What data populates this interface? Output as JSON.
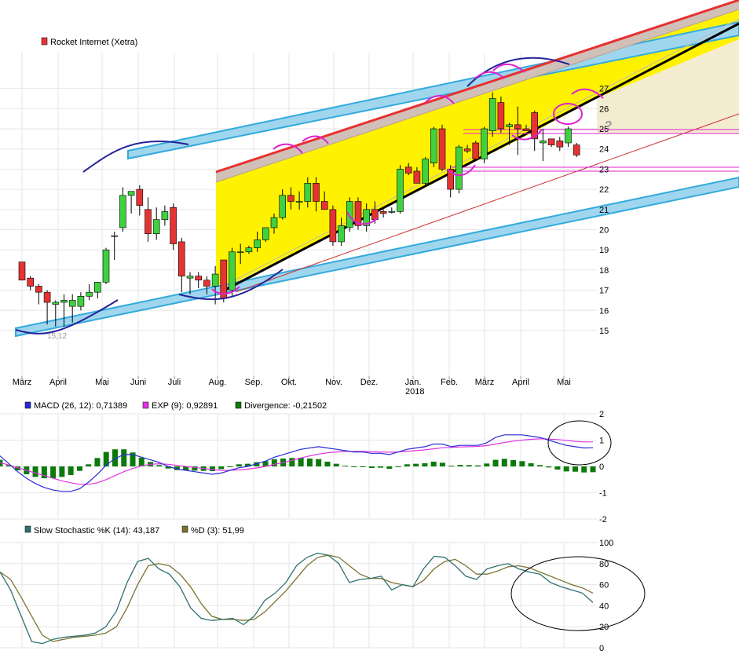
{
  "colors": {
    "up": "#3fd13f",
    "down": "#e53333",
    "macd": "#2b2bd6",
    "signal": "#e033e0",
    "divergence": "#0a7a0a",
    "stoch_k": "#2e7070",
    "stoch_d": "#7a7330",
    "channel_fill": "#fff200",
    "band_blue": "#33aadd",
    "annot_blue": "#232399",
    "annot_magenta": "#e020d0"
  },
  "chart_data": [
    {
      "type": "candlestick",
      "legend": "Rocket Internet (Xetra)",
      "ylim": [
        14,
        28
      ],
      "y_ticks": [
        15,
        16,
        17,
        18,
        19,
        20,
        21,
        22,
        23,
        24,
        25,
        26,
        27
      ],
      "x_tick_labels": [
        "März",
        "April",
        "Mai",
        "Juni",
        "Juli",
        "Aug.",
        "Sep.",
        "Okt.",
        "Nov.",
        "Dez.",
        "Jan.",
        "Feb.",
        "März",
        "April",
        "Mai"
      ],
      "x_sub_label": "2018",
      "low_label": "15,12",
      "question_mark": "?",
      "candles": [
        {
          "o": 18.4,
          "h": 18.4,
          "l": 17.6,
          "c": 17.5
        },
        {
          "o": 17.6,
          "h": 17.7,
          "l": 17.0,
          "c": 17.2
        },
        {
          "o": 17.2,
          "h": 17.3,
          "l": 16.3,
          "c": 16.9
        },
        {
          "o": 16.9,
          "h": 17.0,
          "l": 15.3,
          "c": 16.4
        },
        {
          "o": 16.3,
          "h": 16.5,
          "l": 15.2,
          "c": 16.4
        },
        {
          "o": 16.4,
          "h": 16.8,
          "l": 15.2,
          "c": 16.5
        },
        {
          "o": 16.2,
          "h": 16.8,
          "l": 15.4,
          "c": 16.5
        },
        {
          "o": 16.2,
          "h": 16.9,
          "l": 16.0,
          "c": 16.7
        },
        {
          "o": 16.7,
          "h": 17.3,
          "l": 16.5,
          "c": 16.9
        },
        {
          "o": 16.9,
          "h": 17.4,
          "l": 16.6,
          "c": 17.4
        },
        {
          "o": 17.4,
          "h": 19.1,
          "l": 17.3,
          "c": 19.0
        },
        {
          "o": 19.7,
          "h": 19.9,
          "l": 18.5,
          "c": 19.7
        },
        {
          "o": 20.1,
          "h": 22.1,
          "l": 19.9,
          "c": 21.7
        },
        {
          "o": 21.7,
          "h": 21.9,
          "l": 20.8,
          "c": 21.9
        },
        {
          "o": 22.0,
          "h": 22.2,
          "l": 20.7,
          "c": 21.2
        },
        {
          "o": 21.0,
          "h": 21.6,
          "l": 19.4,
          "c": 19.8
        },
        {
          "o": 19.8,
          "h": 21.1,
          "l": 19.5,
          "c": 20.5
        },
        {
          "o": 20.5,
          "h": 21.2,
          "l": 20.2,
          "c": 20.9
        },
        {
          "o": 21.1,
          "h": 21.3,
          "l": 19.0,
          "c": 19.3
        },
        {
          "o": 19.4,
          "h": 19.6,
          "l": 16.9,
          "c": 17.7
        },
        {
          "o": 17.6,
          "h": 17.9,
          "l": 16.8,
          "c": 17.7
        },
        {
          "o": 17.7,
          "h": 17.9,
          "l": 17.1,
          "c": 17.5
        },
        {
          "o": 17.5,
          "h": 17.7,
          "l": 16.8,
          "c": 17.2
        },
        {
          "o": 17.2,
          "h": 18.2,
          "l": 16.3,
          "c": 17.8
        },
        {
          "o": 18.5,
          "h": 18.5,
          "l": 16.4,
          "c": 16.6
        },
        {
          "o": 17.0,
          "h": 19.1,
          "l": 16.7,
          "c": 18.9
        },
        {
          "o": 18.9,
          "h": 19.3,
          "l": 18.3,
          "c": 18.9
        },
        {
          "o": 18.9,
          "h": 19.2,
          "l": 18.8,
          "c": 19.1
        },
        {
          "o": 19.1,
          "h": 19.9,
          "l": 18.9,
          "c": 19.5
        },
        {
          "o": 19.5,
          "h": 20.1,
          "l": 19.4,
          "c": 20.1
        },
        {
          "o": 20.1,
          "h": 20.8,
          "l": 19.8,
          "c": 20.6
        },
        {
          "o": 20.6,
          "h": 22.0,
          "l": 20.5,
          "c": 21.7
        },
        {
          "o": 21.7,
          "h": 22.1,
          "l": 21.0,
          "c": 21.4
        },
        {
          "o": 21.4,
          "h": 21.9,
          "l": 21.0,
          "c": 21.4
        },
        {
          "o": 21.4,
          "h": 22.6,
          "l": 21.1,
          "c": 22.3
        },
        {
          "o": 22.3,
          "h": 22.6,
          "l": 20.9,
          "c": 21.4
        },
        {
          "o": 21.4,
          "h": 21.9,
          "l": 21.0,
          "c": 21.0
        },
        {
          "o": 21.0,
          "h": 21.2,
          "l": 19.2,
          "c": 19.4
        },
        {
          "o": 19.4,
          "h": 20.6,
          "l": 19.2,
          "c": 20.2
        },
        {
          "o": 20.1,
          "h": 21.6,
          "l": 19.9,
          "c": 21.4
        },
        {
          "o": 21.4,
          "h": 21.6,
          "l": 20.0,
          "c": 20.2
        },
        {
          "o": 20.2,
          "h": 21.3,
          "l": 19.9,
          "c": 21.0
        },
        {
          "o": 21.0,
          "h": 21.4,
          "l": 20.3,
          "c": 20.5
        },
        {
          "o": 20.9,
          "h": 21.0,
          "l": 20.6,
          "c": 20.8
        },
        {
          "o": 20.9,
          "h": 21.1,
          "l": 20.8,
          "c": 20.9
        },
        {
          "o": 20.9,
          "h": 23.2,
          "l": 20.8,
          "c": 23.0
        },
        {
          "o": 23.1,
          "h": 23.3,
          "l": 22.7,
          "c": 22.8
        },
        {
          "o": 22.9,
          "h": 23.1,
          "l": 22.3,
          "c": 22.3
        },
        {
          "o": 22.3,
          "h": 23.6,
          "l": 22.1,
          "c": 23.5
        },
        {
          "o": 23.3,
          "h": 25.1,
          "l": 23.1,
          "c": 25.0
        },
        {
          "o": 25.0,
          "h": 25.2,
          "l": 22.9,
          "c": 23.0
        },
        {
          "o": 23.0,
          "h": 23.2,
          "l": 21.6,
          "c": 22.0
        },
        {
          "o": 22.0,
          "h": 24.2,
          "l": 21.8,
          "c": 24.1
        },
        {
          "o": 24.0,
          "h": 24.2,
          "l": 23.8,
          "c": 23.9
        },
        {
          "o": 24.3,
          "h": 24.4,
          "l": 23.4,
          "c": 23.5
        },
        {
          "o": 23.5,
          "h": 25.1,
          "l": 23.3,
          "c": 25.0
        },
        {
          "o": 24.9,
          "h": 26.8,
          "l": 24.6,
          "c": 26.5
        },
        {
          "o": 26.3,
          "h": 26.6,
          "l": 24.8,
          "c": 25.0
        },
        {
          "o": 25.1,
          "h": 25.3,
          "l": 24.2,
          "c": 25.2
        },
        {
          "o": 25.2,
          "h": 26.1,
          "l": 23.7,
          "c": 25.0
        },
        {
          "o": 25.0,
          "h": 25.2,
          "l": 24.9,
          "c": 24.9
        },
        {
          "o": 25.8,
          "h": 25.9,
          "l": 23.9,
          "c": 24.5
        },
        {
          "o": 24.3,
          "h": 25.0,
          "l": 23.4,
          "c": 24.4
        },
        {
          "o": 24.5,
          "h": 24.5,
          "l": 24.1,
          "c": 24.2
        },
        {
          "o": 24.4,
          "h": 24.6,
          "l": 23.9,
          "c": 24.1
        },
        {
          "o": 24.3,
          "h": 25.1,
          "l": 24.1,
          "c": 25.0
        },
        {
          "o": 24.2,
          "h": 24.3,
          "l": 23.6,
          "c": 23.7
        }
      ]
    },
    {
      "type": "line",
      "legend": [
        {
          "name": "MACD (26, 12): 0,71389"
        },
        {
          "name": "EXP (9): 0,92891"
        },
        {
          "name": "Divergence: -0,21502"
        }
      ],
      "ylim": [
        -2,
        2
      ],
      "y_ticks": [
        -2,
        -1,
        0,
        1,
        2
      ],
      "macd": [
        0.4,
        0.1,
        -0.2,
        -0.45,
        -0.65,
        -0.8,
        -0.9,
        -0.95,
        -0.95,
        -0.85,
        -0.6,
        -0.3,
        0.05,
        0.3,
        0.45,
        0.45,
        0.35,
        0.25,
        0.15,
        0.0,
        -0.1,
        -0.15,
        -0.2,
        -0.25,
        -0.3,
        -0.25,
        -0.15,
        -0.05,
        0.0,
        0.1,
        0.2,
        0.35,
        0.45,
        0.55,
        0.65,
        0.7,
        0.75,
        0.7,
        0.65,
        0.6,
        0.55,
        0.55,
        0.5,
        0.5,
        0.45,
        0.55,
        0.65,
        0.7,
        0.75,
        0.85,
        0.85,
        0.75,
        0.8,
        0.8,
        0.8,
        0.9,
        1.1,
        1.2,
        1.2,
        1.2,
        1.15,
        1.1,
        1.0,
        0.9,
        0.8,
        0.75,
        0.7,
        0.71
      ],
      "signal": [
        0.15,
        0.05,
        -0.05,
        -0.15,
        -0.25,
        -0.35,
        -0.45,
        -0.55,
        -0.62,
        -0.68,
        -0.68,
        -0.62,
        -0.5,
        -0.35,
        -0.2,
        -0.08,
        0.02,
        0.08,
        0.1,
        0.08,
        0.04,
        0.0,
        -0.04,
        -0.08,
        -0.12,
        -0.15,
        -0.15,
        -0.13,
        -0.1,
        -0.06,
        0.0,
        0.08,
        0.15,
        0.23,
        0.32,
        0.4,
        0.47,
        0.52,
        0.55,
        0.57,
        0.57,
        0.57,
        0.56,
        0.55,
        0.54,
        0.55,
        0.57,
        0.6,
        0.63,
        0.67,
        0.71,
        0.72,
        0.74,
        0.75,
        0.76,
        0.79,
        0.85,
        0.91,
        0.96,
        1.0,
        1.03,
        1.05,
        1.04,
        1.02,
        0.99,
        0.95,
        0.93,
        0.93
      ],
      "divergence": [
        0.25,
        0.05,
        -0.15,
        -0.3,
        -0.4,
        -0.45,
        -0.45,
        -0.4,
        -0.33,
        -0.17,
        0.08,
        0.32,
        0.55,
        0.65,
        0.65,
        0.53,
        0.33,
        0.17,
        0.05,
        -0.08,
        -0.14,
        -0.15,
        -0.16,
        -0.17,
        -0.18,
        -0.1,
        0.0,
        0.08,
        0.1,
        0.16,
        0.2,
        0.27,
        0.3,
        0.32,
        0.33,
        0.3,
        0.28,
        0.18,
        0.1,
        0.03,
        -0.02,
        -0.02,
        -0.06,
        -0.05,
        -0.09,
        0.0,
        0.08,
        0.1,
        0.12,
        0.18,
        0.14,
        0.03,
        0.06,
        0.05,
        0.04,
        0.11,
        0.25,
        0.29,
        0.24,
        0.2,
        0.12,
        0.05,
        -0.04,
        -0.12,
        -0.19,
        -0.2,
        -0.23,
        -0.22
      ]
    },
    {
      "type": "line",
      "legend": [
        {
          "name": "Slow Stochastic %K (14): 43,187"
        },
        {
          "name": "%D (3): 51,99"
        }
      ],
      "ylim": [
        0,
        100
      ],
      "y_ticks": [
        0,
        20,
        40,
        60,
        80,
        100
      ],
      "k": [
        72,
        55,
        30,
        6,
        4,
        8,
        10,
        11,
        12,
        14,
        20,
        35,
        62,
        82,
        85,
        75,
        70,
        58,
        38,
        28,
        26,
        27,
        28,
        22,
        30,
        45,
        52,
        62,
        78,
        86,
        90,
        88,
        80,
        62,
        65,
        66,
        68,
        55,
        60,
        58,
        75,
        87,
        86,
        78,
        68,
        65,
        75,
        78,
        80,
        75,
        72,
        70,
        62,
        58,
        55,
        52,
        43
      ],
      "d": [
        72,
        65,
        48,
        30,
        12,
        6,
        8,
        10,
        11,
        12,
        14,
        20,
        38,
        60,
        78,
        80,
        78,
        70,
        58,
        42,
        30,
        27,
        27,
        26,
        27,
        34,
        44,
        54,
        66,
        78,
        86,
        88,
        86,
        78,
        70,
        66,
        66,
        62,
        60,
        58,
        64,
        75,
        82,
        84,
        78,
        70,
        70,
        73,
        77,
        78,
        76,
        72,
        68,
        64,
        60,
        57,
        52
      ]
    }
  ]
}
